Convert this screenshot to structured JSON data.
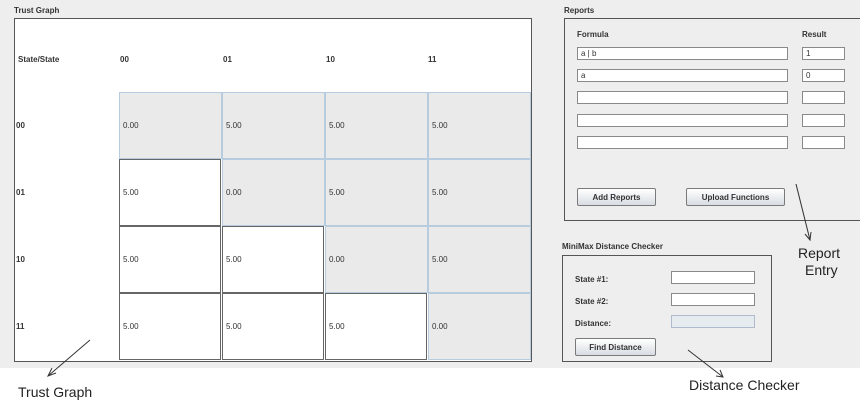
{
  "trust_graph": {
    "title": "Trust Graph",
    "corner_label": "State/State",
    "columns": [
      "00",
      "01",
      "10",
      "11"
    ],
    "rows": [
      {
        "state": "00",
        "values": [
          "0.00",
          "5.00",
          "5.00",
          "5.00"
        ]
      },
      {
        "state": "01",
        "values": [
          "5.00",
          "0.00",
          "5.00",
          "5.00"
        ]
      },
      {
        "state": "10",
        "values": [
          "5.00",
          "5.00",
          "0.00",
          "5.00"
        ]
      },
      {
        "state": "11",
        "values": [
          "5.00",
          "5.00",
          "5.00",
          "0.00"
        ]
      }
    ]
  },
  "reports": {
    "title": "Reports",
    "formula_header": "Formula",
    "result_header": "Result",
    "entries": [
      {
        "formula": "a | b",
        "result": "1"
      },
      {
        "formula": "a",
        "result": "0"
      },
      {
        "formula": "",
        "result": ""
      },
      {
        "formula": "",
        "result": ""
      },
      {
        "formula": "",
        "result": ""
      }
    ],
    "add_button": "Add Reports",
    "upload_button": "Upload Functions"
  },
  "minimax": {
    "title": "MiniMax Distance Checker",
    "state1_label": "State #1:",
    "state1_value": "",
    "state2_label": "State #2:",
    "state2_value": "",
    "distance_label": "Distance:",
    "distance_value": "",
    "find_button": "Find Distance"
  },
  "annotations": {
    "trust_graph": "Trust Graph",
    "report_entry_line1": "Report",
    "report_entry_line2": "Entry",
    "distance_checker": "Distance Checker"
  }
}
